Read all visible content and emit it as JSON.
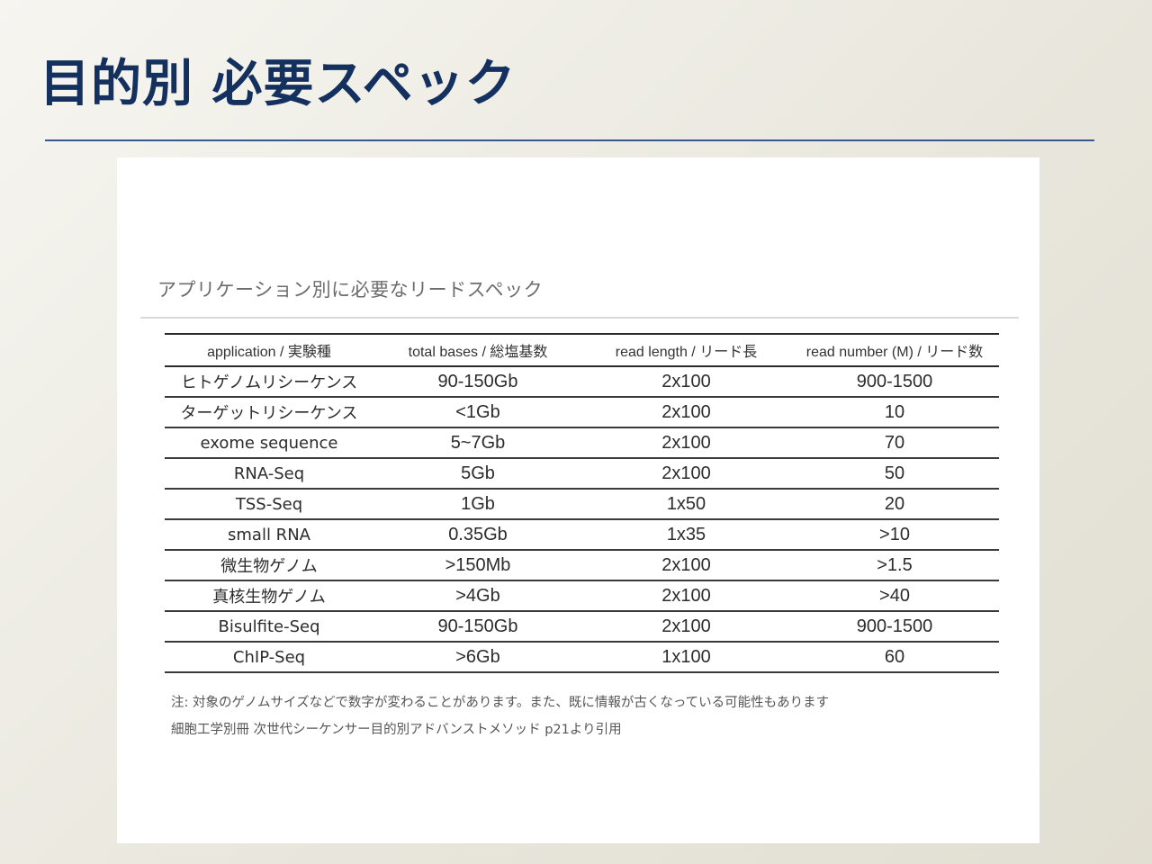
{
  "slide": {
    "title": "目的別 必要スペック"
  },
  "figure": {
    "caption": "アプリケーション別に必要なリードスペック",
    "table": {
      "headers": [
        "application / 実験種",
        "total bases / 総塩基数",
        "read length / リード長",
        "read number (M) / リード数"
      ],
      "rows": [
        [
          "ヒトゲノムリシーケンス",
          "90-150Gb",
          "2x100",
          "900-1500"
        ],
        [
          "ターゲットリシーケンス",
          "<1Gb",
          "2x100",
          "10"
        ],
        [
          "exome sequence",
          "5~7Gb",
          "2x100",
          "70"
        ],
        [
          "RNA-Seq",
          "5Gb",
          "2x100",
          "50"
        ],
        [
          "TSS-Seq",
          "1Gb",
          "1x50",
          "20"
        ],
        [
          "small RNA",
          "0.35Gb",
          "1x35",
          ">10"
        ],
        [
          "微生物ゲノム",
          ">150Mb",
          "2x100",
          ">1.5"
        ],
        [
          "真核生物ゲノム",
          ">4Gb",
          "2x100",
          ">40"
        ],
        [
          "Bisulfite-Seq",
          "90-150Gb",
          "2x100",
          "900-1500"
        ],
        [
          "ChIP-Seq",
          ">6Gb",
          "1x100",
          "60"
        ]
      ]
    },
    "note": "注: 対象のゲノムサイズなどで数字が変わることがあります。また、既に情報が古くなっている可能性もあります",
    "source": "細胞工学別冊 次世代シーケンサー目的別アドバンストメソッド p21より引用"
  }
}
